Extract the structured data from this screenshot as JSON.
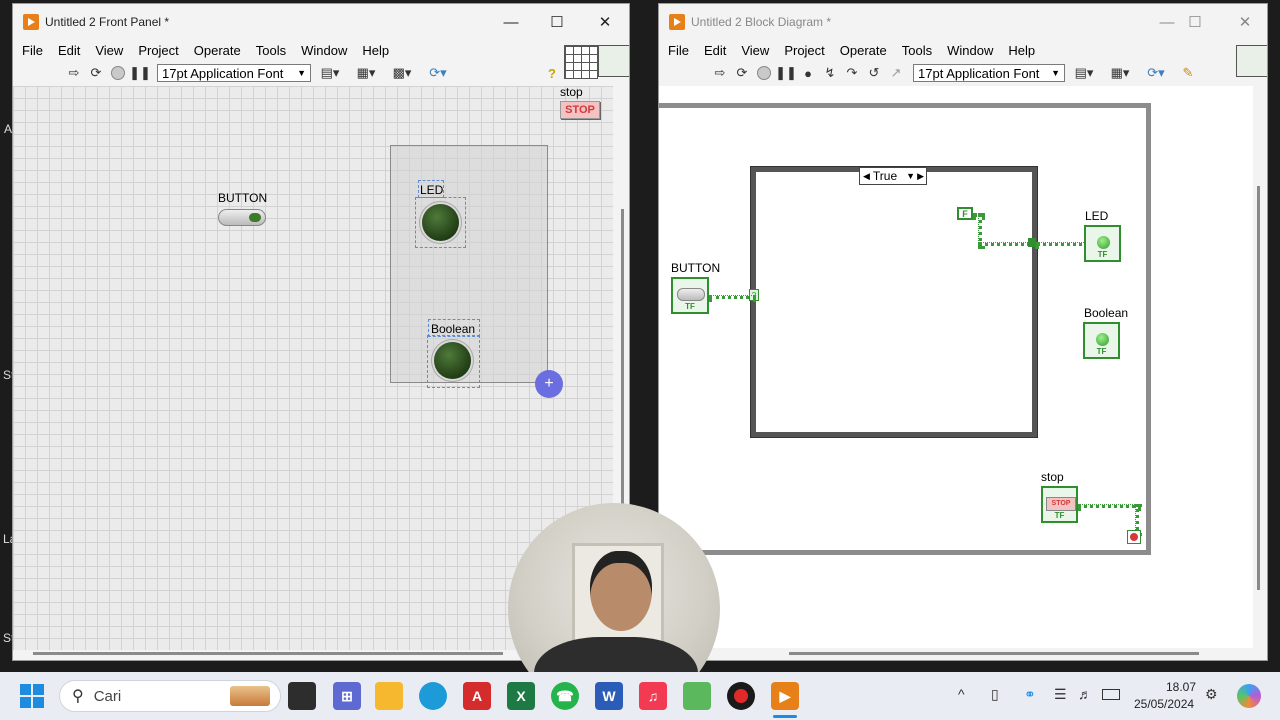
{
  "front_panel": {
    "title": "Untitled 2 Front Panel *",
    "menu": [
      "File",
      "Edit",
      "View",
      "Project",
      "Operate",
      "Tools",
      "Window",
      "Help"
    ],
    "font_select": "17pt Application Font",
    "controls": {
      "button_label": "BUTTON",
      "led_label": "LED",
      "boolean_label": "Boolean",
      "stop_label": "stop",
      "stop_text": "STOP"
    },
    "left_edge_letters": [
      "A",
      "St",
      "La",
      "St"
    ]
  },
  "block_diagram": {
    "title": "Untitled 2 Block Diagram *",
    "menu": [
      "File",
      "Edit",
      "View",
      "Project",
      "Operate",
      "Tools",
      "Window",
      "Help"
    ],
    "font_select": "17pt Application Font",
    "case_selector": "True",
    "false_constant": "F",
    "terminals": {
      "button_label": "BUTTON",
      "led_label": "LED",
      "boolean_label": "Boolean",
      "stop_label": "stop",
      "stop_text": "STOP",
      "tf": "TF"
    },
    "select_tunnel": "?"
  },
  "taskbar": {
    "search_placeholder": "Cari",
    "time": "18.07",
    "date": "25/05/2024",
    "pinned_icons": [
      "file-explorer-icon",
      "calculator-icon",
      "folder-icon",
      "edge-icon",
      "acrobat-icon",
      "excel-icon",
      "whatsapp-icon",
      "word-icon",
      "music-icon",
      "android-icon",
      "record-icon",
      "labview-icon"
    ]
  },
  "colors": {
    "accent_orange": "#e8801a",
    "terminal_green": "#2f8f2f",
    "led_dark": "#2a4a1a",
    "stop_red": "#d43a3a",
    "cursor_blue": "#6b6ee0"
  }
}
